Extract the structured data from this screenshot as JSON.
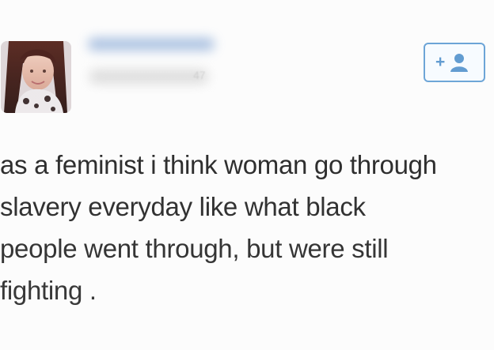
{
  "tweet": {
    "follow_button_icon": "add-user-icon",
    "follow_button_symbol": "+",
    "blurred_number": "47",
    "text_lines": [
      "as a feminist i think woman go through",
      "slavery everyday like what black",
      "people went through, but were still",
      "fighting ."
    ]
  },
  "colors": {
    "text": "#222222",
    "accent": "#6aa3d6",
    "background": "#ffffff"
  }
}
